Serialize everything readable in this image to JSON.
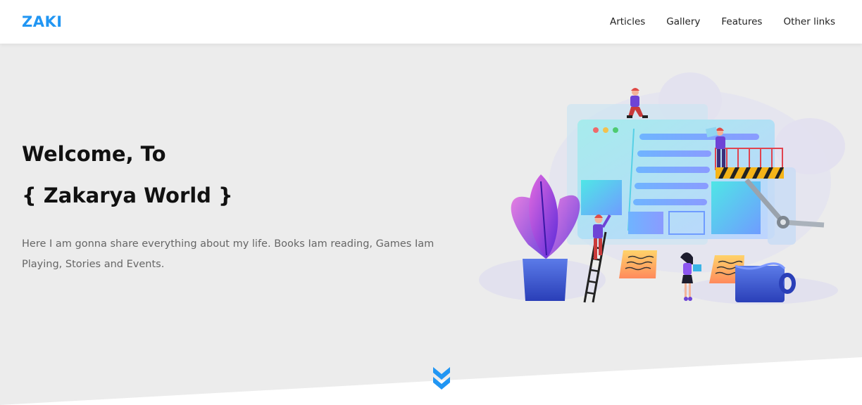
{
  "header": {
    "logo": "ZAKI",
    "nav": [
      {
        "label": "Articles"
      },
      {
        "label": "Gallery"
      },
      {
        "label": "Features"
      },
      {
        "label": "Other links"
      }
    ]
  },
  "hero": {
    "title_line1": "Welcome, To",
    "title_line2": "{ Zakarya World }",
    "description": "Here I am gonna share everything about my life. Books Iam reading, Games Iam Playing, Stories and Events."
  },
  "icons": {
    "scroll_down": "double-chevron-down-icon",
    "illustration": "web-construction-illustration"
  },
  "colors": {
    "brand": "#2196f3",
    "background": "#ececec",
    "header_bg": "#ffffff",
    "title_text": "#111111",
    "body_text": "#666666"
  }
}
